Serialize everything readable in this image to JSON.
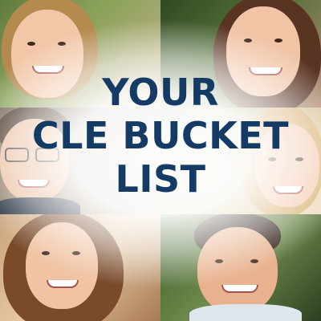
{
  "headline": {
    "line1": "YOUR",
    "line2": "CLE BUCKET",
    "line3": "LIST"
  },
  "colors": {
    "headline_text": "#133b65",
    "background_glow": "#ffffff"
  }
}
